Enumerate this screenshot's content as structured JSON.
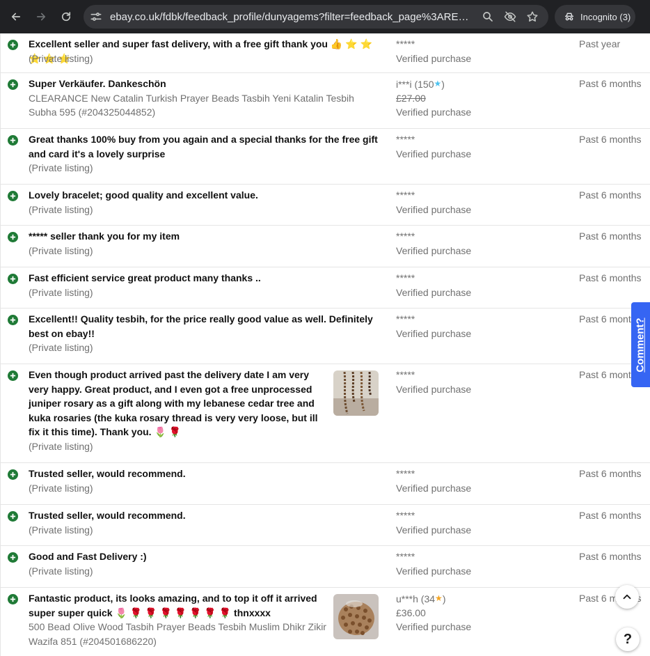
{
  "browser": {
    "url": "ebay.co.uk/fdbk/feedback_profile/dunyagems?filter=feedback_page%3ARECEIVED...",
    "incognito_label": "Incognito (3)"
  },
  "colors": {
    "positive": "#1f7a36",
    "accent": "#3665f3",
    "muted": "#707070"
  },
  "rows": [
    {
      "comment": "Excellent seller and super fast delivery, with a free gift thank you 👍 ⭐ ⭐ ⭐ ⭐ ⭐",
      "listing": "(Private listing)",
      "buyer": "*****",
      "verified": "Verified purchase",
      "time": "Past year"
    },
    {
      "comment": "Super Verkäufer. Dankeschön",
      "listing": "CLEARANCE New Catalin Turkish Prayer Beads Tasbih Yeni Katalin Tesbih Subha 595 (#204325044852)",
      "buyer": "i***i (150",
      "buyer_star": "★",
      "buyer_suffix": ")",
      "buyer_star_color": "#4dc3f0",
      "price": "£27.00",
      "verified": "Verified purchase",
      "time": "Past 6 months"
    },
    {
      "comment": "Great thanks 100% buy from you again and a special thanks for the free gift and card it's a lovely surprise",
      "listing": "(Private listing)",
      "buyer": "*****",
      "verified": "Verified purchase",
      "time": "Past 6 months"
    },
    {
      "comment": "Lovely bracelet; good quality and excellent value.",
      "listing": "(Private listing)",
      "buyer": "*****",
      "verified": "Verified purchase",
      "time": "Past 6 months"
    },
    {
      "comment": "***** seller thank you for my item",
      "listing": "(Private listing)",
      "buyer": "*****",
      "verified": "Verified purchase",
      "time": "Past 6 months"
    },
    {
      "comment": "Fast efficient service great product many thanks ..",
      "listing": "(Private listing)",
      "buyer": "*****",
      "verified": "Verified purchase",
      "time": "Past 6 months"
    },
    {
      "comment": "Excellent!! Quality tesbih, for the price really good value as well. Definitely best on ebay!!",
      "listing": "(Private listing)",
      "buyer": "*****",
      "verified": "Verified purchase",
      "time": "Past 6 months"
    },
    {
      "comment": "Even though product arrived past the delivery date I am very very happy. Great product, and I even got a free unprocessed juniper rosary as a gift along with my lebanese cedar tree and kuka rosaries (the kuka rosary thread is very very loose, but ill fix it this time). Thank you. 🌷 🌹",
      "listing": "(Private listing)",
      "buyer": "*****",
      "verified": "Verified purchase",
      "time": "Past 6 months"
    },
    {
      "comment": "Trusted seller, would recommend.",
      "listing": "(Private listing)",
      "buyer": "*****",
      "verified": "Verified purchase",
      "time": "Past 6 months"
    },
    {
      "comment": "Trusted seller, would recommend.",
      "listing": "(Private listing)",
      "buyer": "*****",
      "verified": "Verified purchase",
      "time": "Past 6 months"
    },
    {
      "comment": "Good and Fast Delivery :)",
      "listing": "(Private listing)",
      "buyer": "*****",
      "verified": "Verified purchase",
      "time": "Past 6 months"
    },
    {
      "comment": "Fantastic product, its looks amazing, and to top it off it arrived super super quick 🌷 🌹 🌹 🌹 🌹 🌹 🌹 🌹 thnxxxx",
      "listing": "500 Bead Olive Wood Tasbih Prayer Beads Tesbih Muslim Dhikr Zikir Wazifa 851 (#204501686220)",
      "buyer": "u***h (34",
      "buyer_star": "★",
      "buyer_suffix": ")",
      "buyer_star_color": "#f5a623",
      "price": "£36.00",
      "verified": "Verified purchase",
      "time": "Past 6 months"
    }
  ],
  "comment_tab": "Comment?",
  "help_label": "?"
}
